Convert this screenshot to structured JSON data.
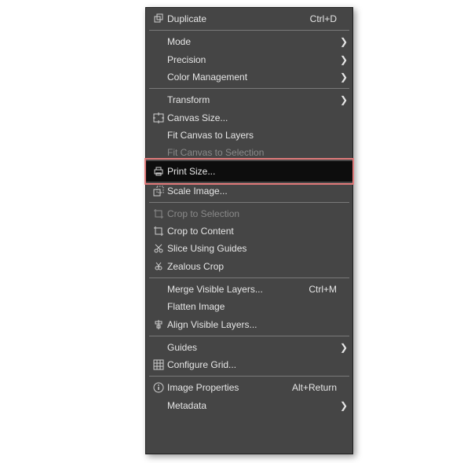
{
  "menu": {
    "duplicate": {
      "label": "Duplicate",
      "shortcut": "Ctrl+D"
    },
    "mode": {
      "label": "Mode"
    },
    "precision": {
      "label": "Precision"
    },
    "color_management": {
      "label": "Color Management"
    },
    "transform": {
      "label": "Transform"
    },
    "canvas_size": {
      "label": "Canvas Size..."
    },
    "fit_canvas_layers": {
      "label": "Fit Canvas to Layers"
    },
    "fit_canvas_selection": {
      "label": "Fit Canvas to Selection"
    },
    "print_size": {
      "label": "Print Size..."
    },
    "scale_image": {
      "label": "Scale Image..."
    },
    "crop_to_selection": {
      "label": "Crop to Selection"
    },
    "crop_to_content": {
      "label": "Crop to Content"
    },
    "slice_guides": {
      "label": "Slice Using Guides"
    },
    "zealous_crop": {
      "label": "Zealous Crop"
    },
    "merge_visible": {
      "label": "Merge Visible Layers...",
      "shortcut": "Ctrl+M"
    },
    "flatten": {
      "label": "Flatten Image"
    },
    "align_visible": {
      "label": "Align Visible Layers..."
    },
    "guides": {
      "label": "Guides"
    },
    "configure_grid": {
      "label": "Configure Grid..."
    },
    "image_properties": {
      "label": "Image Properties",
      "shortcut": "Alt+Return"
    },
    "metadata": {
      "label": "Metadata"
    }
  },
  "icons": {
    "duplicate": "duplicate-icon",
    "canvas_size": "canvas-size-icon",
    "print_size": "print-icon",
    "scale_image": "scale-icon",
    "crop_to_selection": "crop-icon",
    "crop_to_content": "crop-icon",
    "slice_guides": "slice-icon",
    "zealous_crop": "zealous-crop-icon",
    "align_visible": "align-icon",
    "configure_grid": "grid-icon",
    "image_properties": "info-icon"
  }
}
